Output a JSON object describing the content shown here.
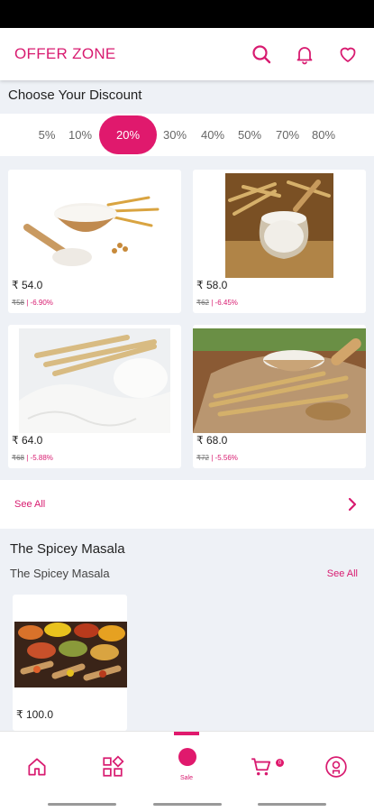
{
  "header": {
    "title": "OFFER ZONE"
  },
  "discount": {
    "title": "Choose Your Discount",
    "options": [
      "5%",
      "10%",
      "20%",
      "30%",
      "40%",
      "50%",
      "70%",
      "80%"
    ],
    "selected": "20%"
  },
  "products": [
    {
      "price": "₹ 54.0",
      "old_price": "₹58",
      "discount": "| -6.90%"
    },
    {
      "price": "₹ 58.0",
      "old_price": "₹62",
      "discount": "| -6.45%"
    },
    {
      "price": "₹ 64.0",
      "old_price": "₹68",
      "discount": "| -5.88%"
    },
    {
      "price": "₹ 68.0",
      "old_price": "₹72",
      "discount": "| -5.56%"
    }
  ],
  "see_all_label": "See All",
  "masala": {
    "title": "The Spicey Masala",
    "subtitle": "The Spicey Masala",
    "see_all": "See All",
    "products": [
      {
        "price": "₹ 100.0"
      }
    ]
  },
  "bottom_nav": {
    "sale_label": "Sale",
    "cart_badge": "0",
    "active_tab": "Sale"
  },
  "colors": {
    "accent": "#e0196d",
    "background": "#eef1f6"
  }
}
